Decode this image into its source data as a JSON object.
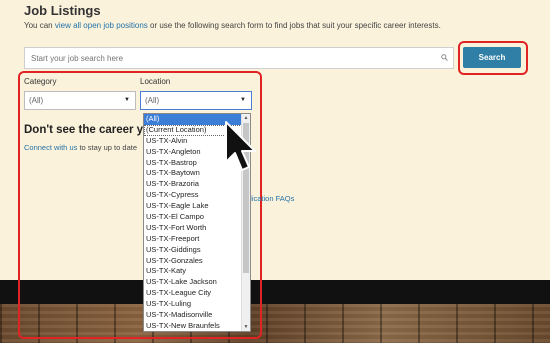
{
  "page": {
    "title": "Job Listings",
    "intro_before": "You can ",
    "intro_link": "view all open job positions",
    "intro_after": " or use the following search form to find jobs that suit your specific career interests."
  },
  "search": {
    "placeholder": "Start your job search here",
    "button_label": "Search"
  },
  "filters": {
    "category_label": "Category",
    "category_value": "(All)",
    "location_label": "Location",
    "location_value": "(All)"
  },
  "career": {
    "heading": "Don't see the career you",
    "connect_link": "Connect with us",
    "connect_after": " to stay up to date",
    "faqs_link": "plication FAQs"
  },
  "location_options": [
    "(All)",
    "(Current Location)",
    "US-TX-Alvin",
    "US-TX-Angleton",
    "US-TX-Bastrop",
    "US-TX-Baytown",
    "US-TX-Brazoria",
    "US-TX-Cypress",
    "US-TX-Eagle Lake",
    "US-TX-El Campo",
    "US-TX-Fort Worth",
    "US-TX-Freeport",
    "US-TX-Giddings",
    "US-TX-Gonzales",
    "US-TX-Katy",
    "US-TX-Lake Jackson",
    "US-TX-League City",
    "US-TX-Luling",
    "US-TX-Madisonville",
    "US-TX-New Braunfels"
  ],
  "colors": {
    "accent": "#2f7fa6",
    "highlight": "#e02424",
    "selected_option": "#3b7ed8",
    "page_background": "#fbf2dc"
  }
}
